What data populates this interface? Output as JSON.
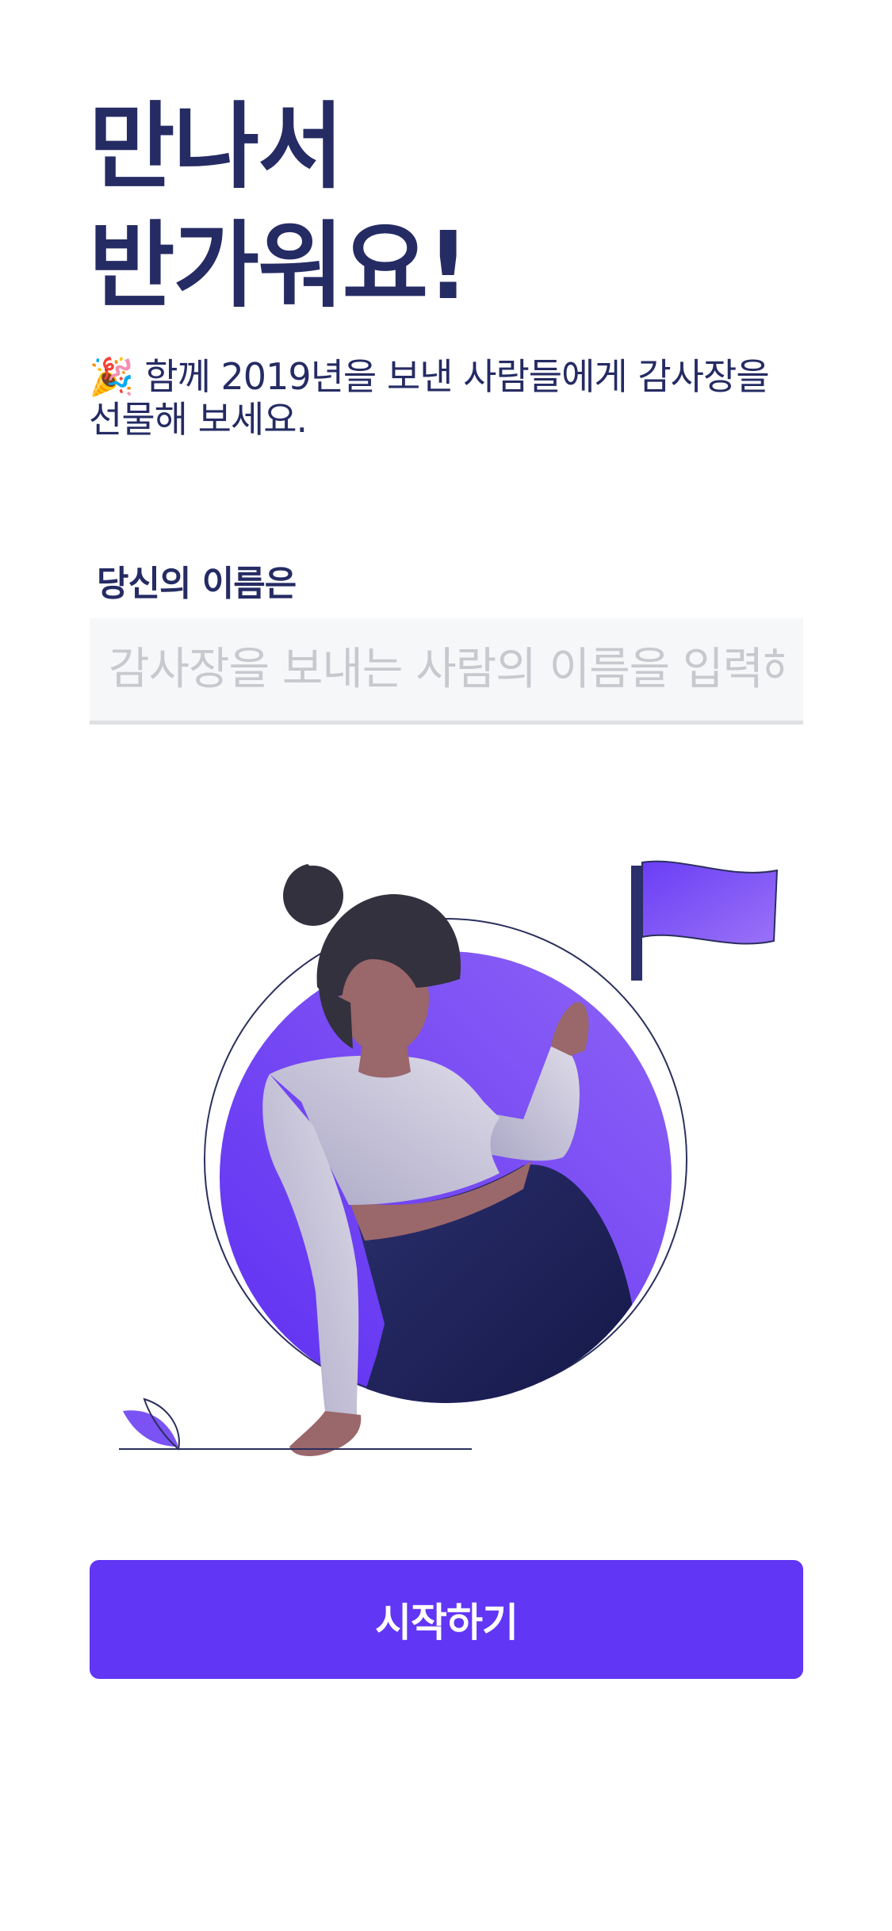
{
  "intro": {
    "headline_line1": "만나서",
    "headline_line2": "반가워요!",
    "emoji": "🎉",
    "subtitle": "함께 2019년을 보낸 사람들에게 감사장을 선물해 보세요."
  },
  "name_field": {
    "label": "당신의 이름은",
    "placeholder": "감사장을 보내는 사람의 이름을 입력해 주세요",
    "value": ""
  },
  "illustration": {
    "icon": "woman-holding-flag-illustration"
  },
  "actions": {
    "start_label": "시작하기"
  },
  "colors": {
    "primary": "#6236f5",
    "text": "#252b63",
    "input_bg": "#f6f7f9",
    "placeholder": "#c7c9cf"
  }
}
